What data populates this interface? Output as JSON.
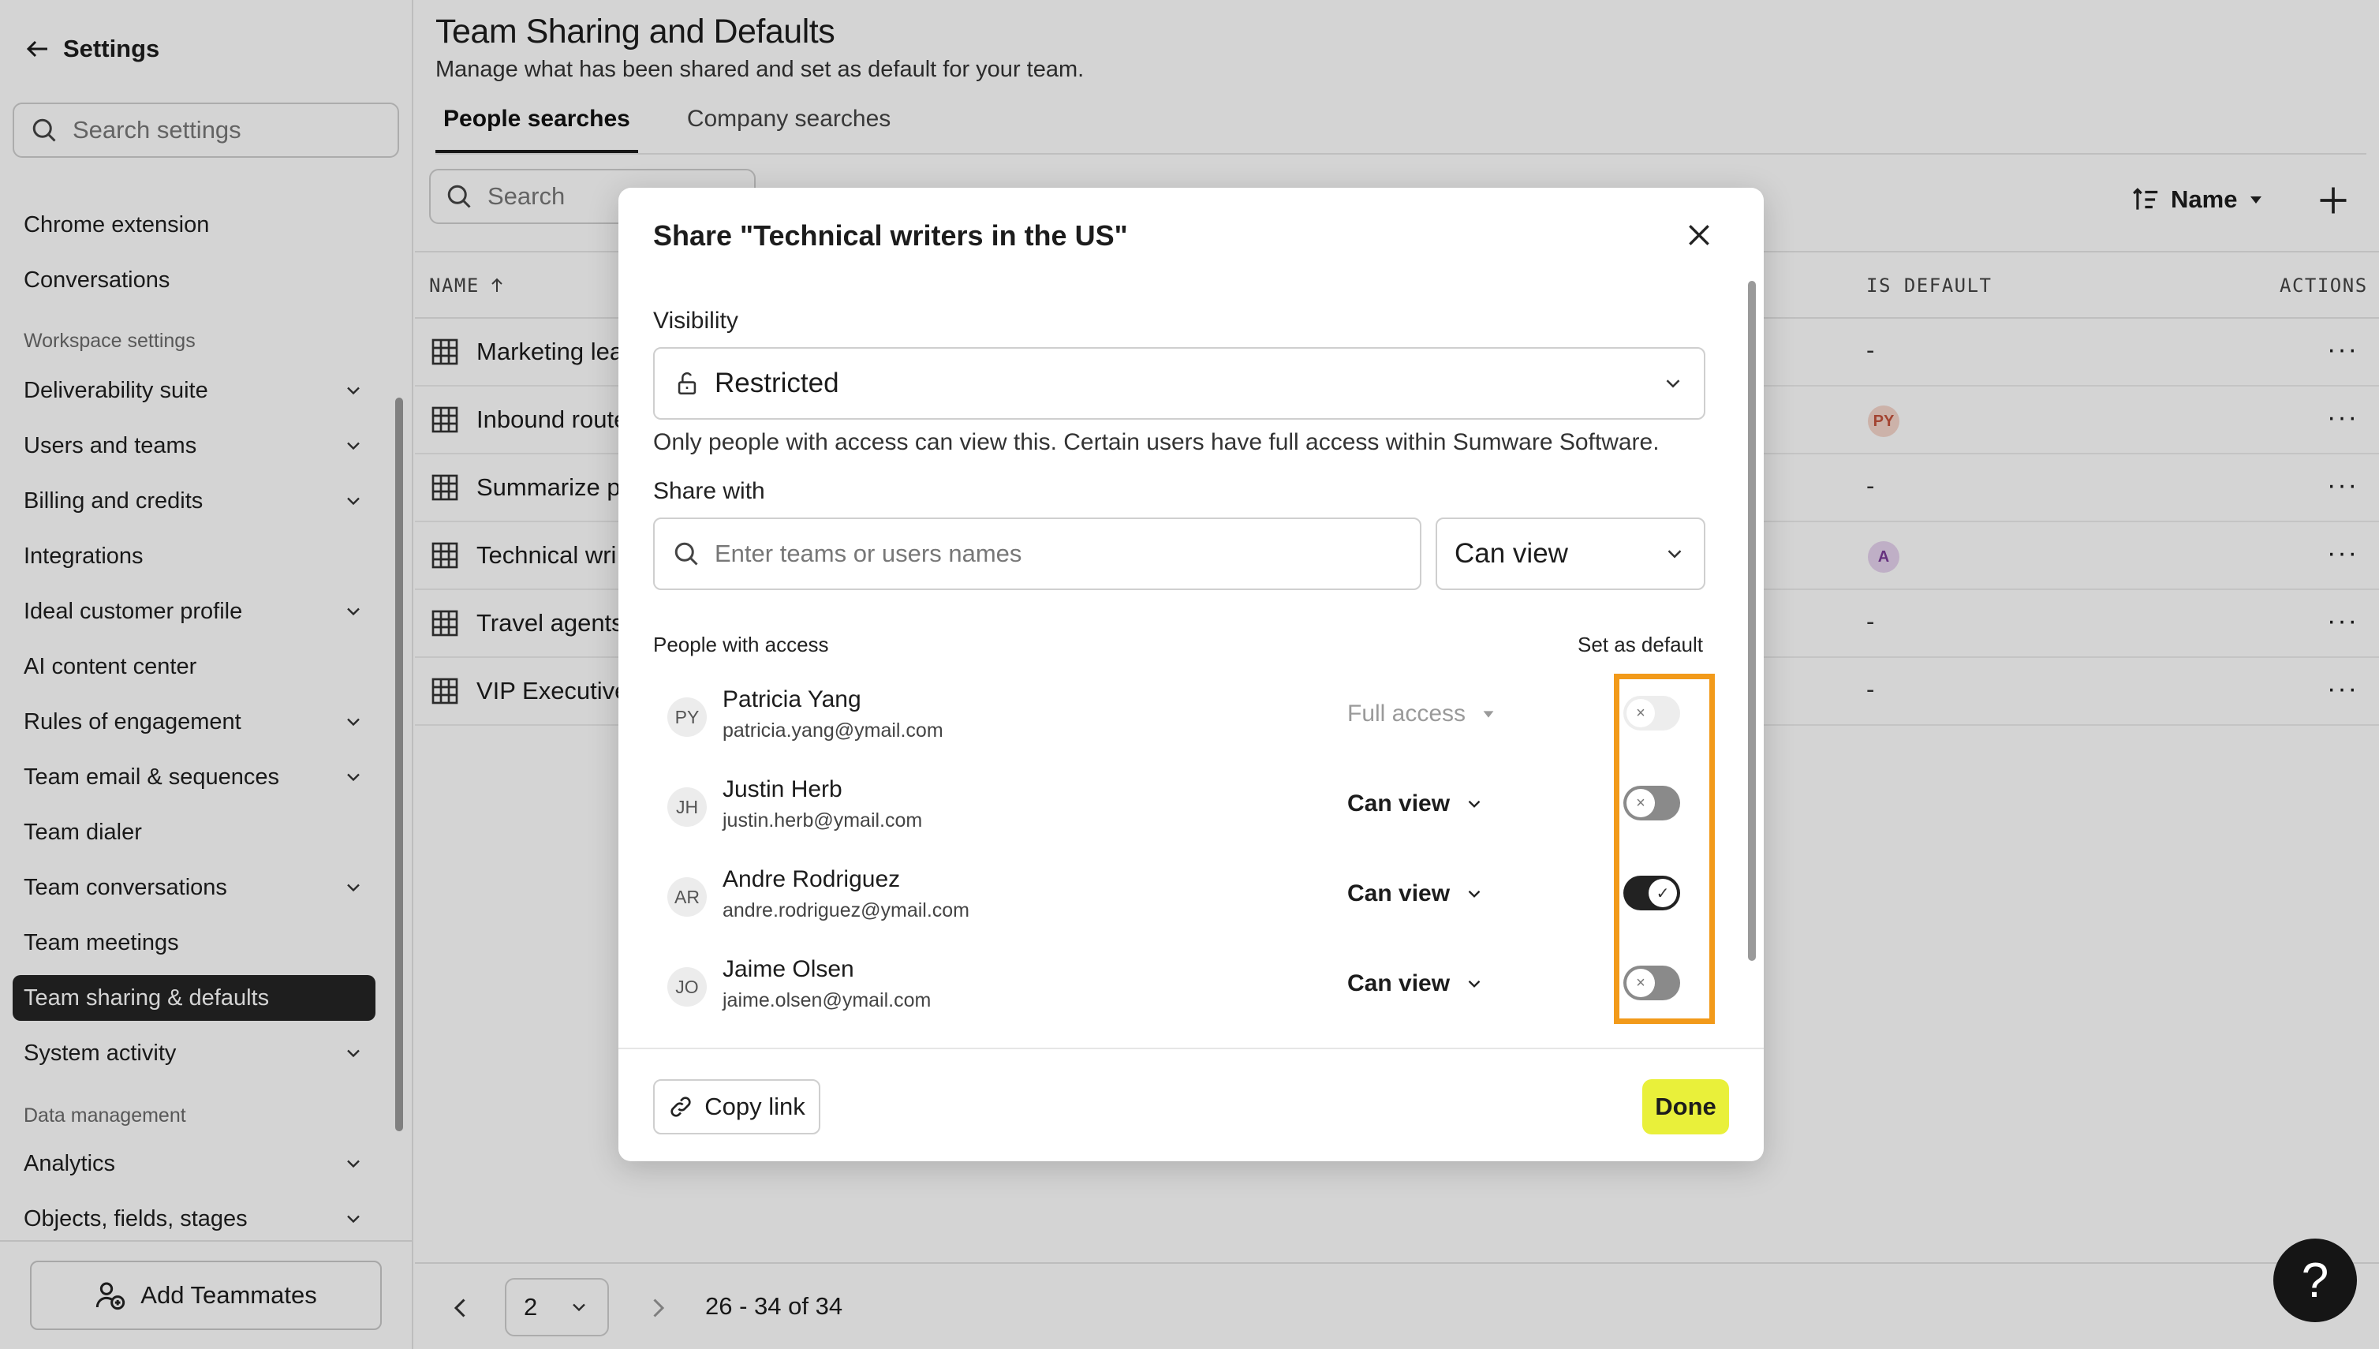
{
  "sidebar": {
    "back_label": "Settings",
    "search_placeholder": "Search settings",
    "items": [
      {
        "label": "Chrome extension"
      },
      {
        "label": "Conversations"
      },
      {
        "section": "Workspace settings"
      },
      {
        "label": "Deliverability suite",
        "expandable": true
      },
      {
        "label": "Users and teams",
        "expandable": true
      },
      {
        "label": "Billing and credits",
        "expandable": true
      },
      {
        "label": "Integrations"
      },
      {
        "label": "Ideal customer profile",
        "expandable": true
      },
      {
        "label": "AI content center"
      },
      {
        "label": "Rules of engagement",
        "expandable": true
      },
      {
        "label": "Team email & sequences",
        "expandable": true
      },
      {
        "label": "Team dialer"
      },
      {
        "label": "Team conversations",
        "expandable": true
      },
      {
        "label": "Team meetings"
      },
      {
        "label": "Team sharing & defaults",
        "active": true
      },
      {
        "label": "System activity",
        "expandable": true
      },
      {
        "section": "Data management"
      },
      {
        "label": "Analytics",
        "expandable": true
      },
      {
        "label": "Objects, fields, stages",
        "expandable": true
      }
    ],
    "add_teammates": "Add Teammates"
  },
  "main": {
    "title": "Team Sharing and Defaults",
    "subtitle": "Manage what has been shared and set as default for your team.",
    "tabs": [
      {
        "label": "People searches",
        "active": true
      },
      {
        "label": "Company searches"
      }
    ],
    "search_placeholder": "Search",
    "sort_label": "Name",
    "columns": {
      "name": "NAME",
      "is_default": "IS DEFAULT",
      "actions": "ACTIONS"
    },
    "rows": [
      {
        "name": "Marketing lea",
        "default": "-"
      },
      {
        "name": "Inbound route",
        "default_avatar": "PY"
      },
      {
        "name": "Summarize p",
        "default": "-"
      },
      {
        "name": "Technical wri",
        "default_avatar": "A"
      },
      {
        "name": "Travel agents",
        "default": "-"
      },
      {
        "name": "VIP Executive",
        "default": "-"
      }
    ],
    "actions_glyph": "···",
    "pagination": {
      "page": "2",
      "range": "26 - 34 of 34"
    },
    "help": "?"
  },
  "modal": {
    "title": "Share \"Technical writers in the US\"",
    "visibility_label": "Visibility",
    "visibility_value": "Restricted",
    "visibility_help": "Only people with access can view this. Certain users have full access within Sumware Software.",
    "share_with_label": "Share with",
    "share_placeholder": "Enter teams or users names",
    "share_permission": "Can view",
    "people_label": "People with access",
    "default_label": "Set as default",
    "people": [
      {
        "initials": "PY",
        "name": "Patricia Yang",
        "email": "patricia.yang@ymail.com",
        "permission": "Full access",
        "perm_disabled": true,
        "toggle": "disabled"
      },
      {
        "initials": "JH",
        "name": "Justin Herb",
        "email": "justin.herb@ymail.com",
        "permission": "Can view",
        "toggle": "off"
      },
      {
        "initials": "AR",
        "name": "Andre Rodriguez",
        "email": "andre.rodriguez@ymail.com",
        "permission": "Can view",
        "toggle": "on"
      },
      {
        "initials": "JO",
        "name": "Jaime Olsen",
        "email": "jaime.olsen@ymail.com",
        "permission": "Can view",
        "toggle": "off"
      }
    ],
    "copy_link": "Copy link",
    "done": "Done",
    "colors": {
      "done_bg": "#e9f03a",
      "highlight": "#f29a1a",
      "active_nav": "#252525"
    }
  }
}
